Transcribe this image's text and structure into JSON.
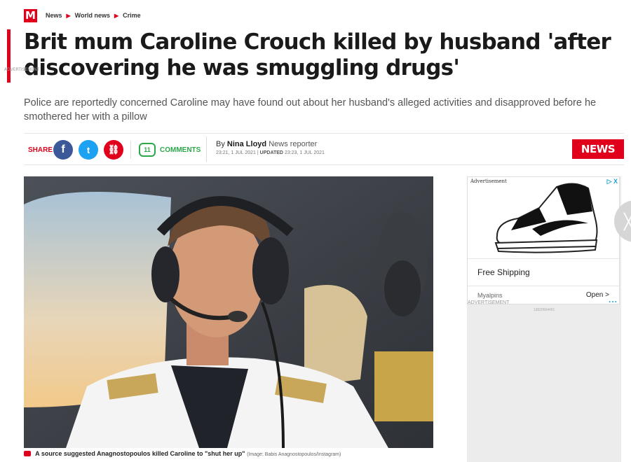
{
  "breadcrumb": {
    "logo": "M",
    "items": [
      "News",
      "World news",
      "Crime"
    ]
  },
  "advert_tiny": "ADVERTISEMENT",
  "article": {
    "headline": "Brit mum Caroline Crouch killed by husband 'after discovering he was smuggling drugs'",
    "standfirst": "Police are reportedly concerned Caroline may have found out about her husband's alleged activities and disapproved before he smothered her with a pillow"
  },
  "share": {
    "label": "SHARE",
    "facebook_glyph": "f",
    "twitter_glyph": "t",
    "link_glyph": "⛓"
  },
  "comments": {
    "count": "11",
    "label": "COMMENTS"
  },
  "byline": {
    "prefix": "By",
    "author": "Nina Lloyd",
    "role": "News reporter",
    "published": "23:21, 1 JUL 2021",
    "updated_label": "UPDATED",
    "updated": "23:23, 1 JUL 2021"
  },
  "section_button": "NEWS",
  "photo": {
    "caption": "A source suggested Anagnostopoulos killed Caroline to \"shut her up\"",
    "credit": "(Image: Babis Anagnostopoulos/Instagram)"
  },
  "ad": {
    "top_label": "Advertisement",
    "choices": "▷ X",
    "title": "Free Shipping",
    "advertiser": "Myalpins",
    "cta": "Open",
    "cta_glyph": ">",
    "label_small": "ADVERTISEMENT",
    "dots": "...",
    "id": "13820664491"
  },
  "colors": {
    "brand_red": "#e0001b",
    "facebook": "#3b5998",
    "twitter": "#1da1f2",
    "comments_green": "#2ba84a"
  },
  "icons": {
    "logo": "mirror-logo",
    "share_fb": "facebook-icon",
    "share_tw": "twitter-icon",
    "share_link": "link-icon",
    "comment": "comment-bubble-icon",
    "camera": "camera-icon",
    "ad_choices": "adchoices-icon",
    "side": "close-icon"
  }
}
